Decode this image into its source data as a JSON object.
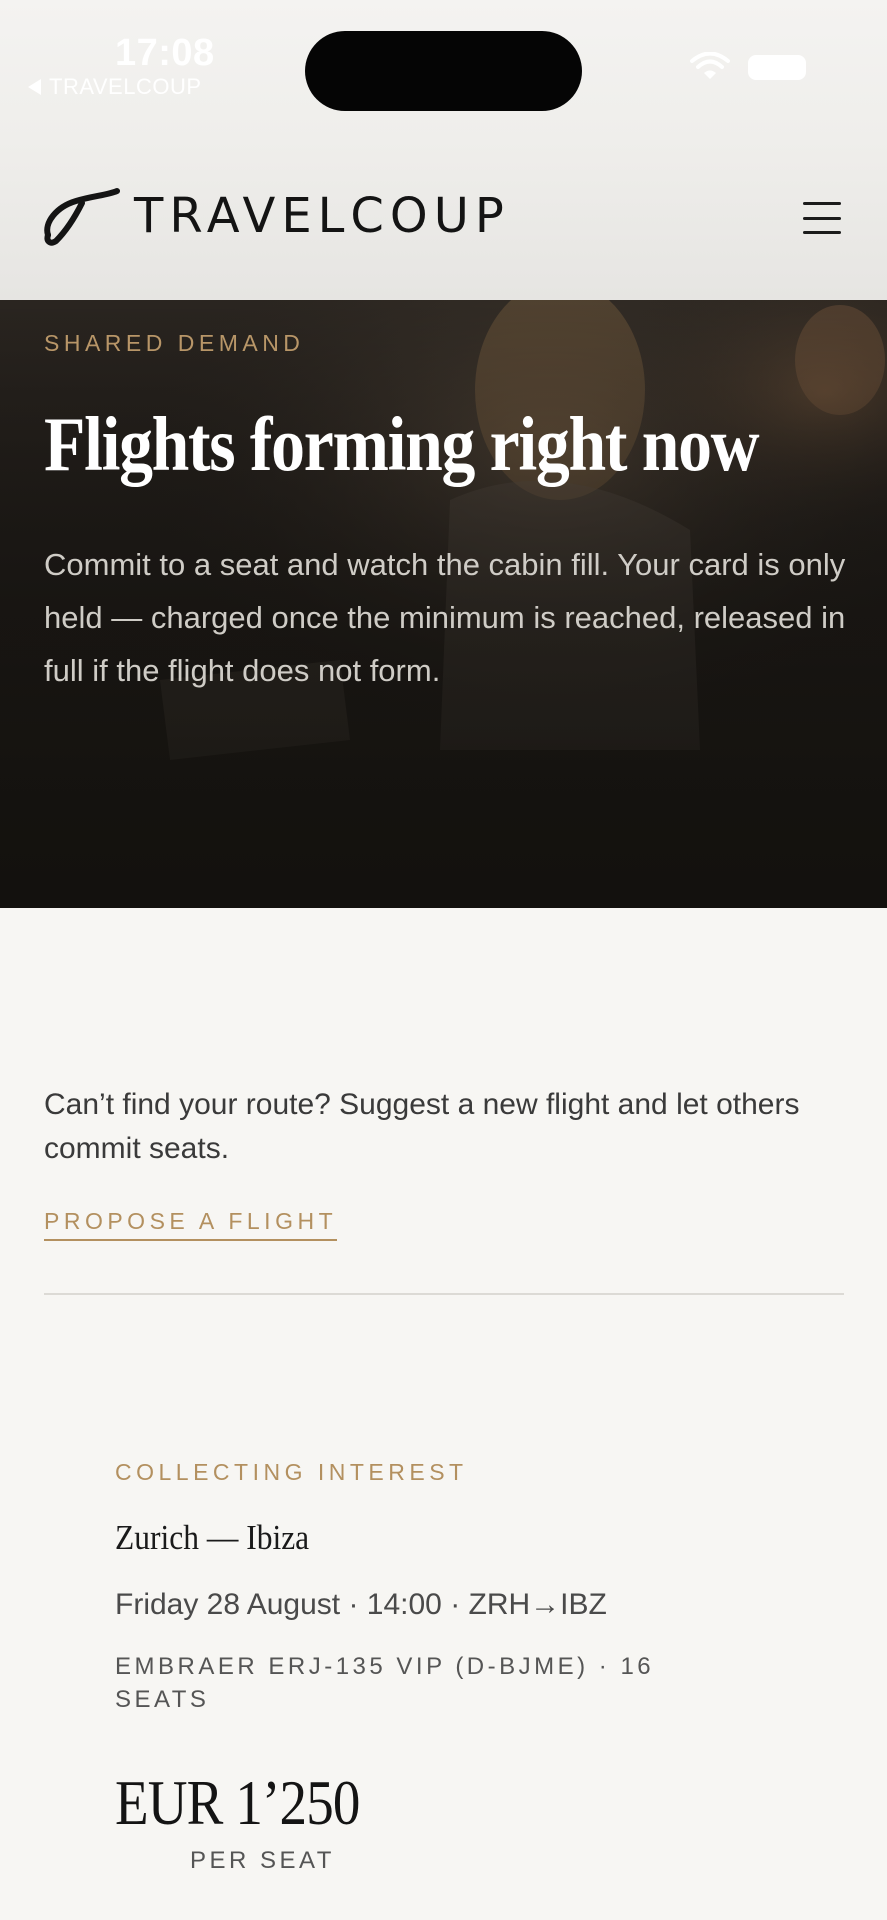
{
  "status_bar": {
    "time": "17:08",
    "back_label": "TRAVELCOUP"
  },
  "header": {
    "brand": "TRAVELCOUP"
  },
  "hero": {
    "eyebrow": "SHARED DEMAND",
    "title": "Flights forming right now",
    "body": "Commit to a seat and watch the cabin fill. Your card is only held — charged once the minimum is reached, released in full if the flight does not form."
  },
  "propose": {
    "text": "Can’t find your route? Suggest a new flight and let others commit seats.",
    "link_label": "PROPOSE A FLIGHT"
  },
  "flight_card": {
    "status": "COLLECTING INTEREST",
    "route": "Zurich — Ibiza",
    "meta": "Friday 28 August · 14:00 · ZRH→IBZ",
    "aircraft": "EMBRAER ERJ-135 VIP (D-BJME) · 16 SEATS",
    "price": "EUR 1’250",
    "price_unit": "PER SEAT"
  },
  "colors": {
    "accent": "#b3905f",
    "hero_bg": "#1c1915",
    "page_bg": "#f7f6f3"
  }
}
